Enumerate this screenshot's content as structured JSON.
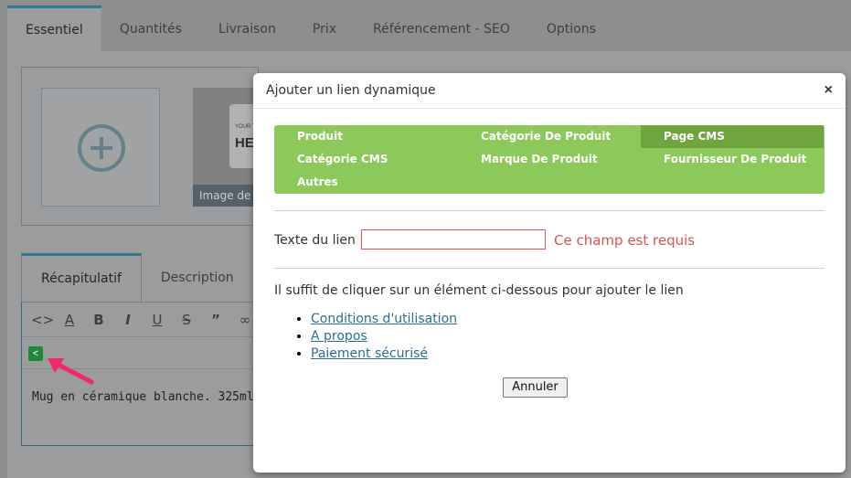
{
  "top_tabs": [
    {
      "label": "Essentiel",
      "active": true
    },
    {
      "label": "Quantités",
      "active": false
    },
    {
      "label": "Livraison",
      "active": false
    },
    {
      "label": "Prix",
      "active": false
    },
    {
      "label": "Référencement - SEO",
      "active": false
    },
    {
      "label": "Options",
      "active": false
    }
  ],
  "image_panel": {
    "thumb_caption": "Image de c",
    "mug_brand_small": "YOUR T",
    "mug_brand_big": "HE"
  },
  "editor": {
    "tabs": [
      {
        "label": "Récapitulatif",
        "active": true
      },
      {
        "label": "Description",
        "active": false
      }
    ],
    "toolbar_icons": [
      "code-icon",
      "font-color-icon",
      "bold-icon",
      "italic-icon",
      "underline-icon",
      "strikethrough-icon",
      "quote-icon",
      "link-icon"
    ],
    "toolbar_glyphs": [
      "<>",
      "A",
      "B",
      "I",
      "U",
      "S",
      "”",
      "∞"
    ],
    "share_glyph": "<",
    "content": "Mug en céramique blanche. 325ml"
  },
  "modal": {
    "title": "Ajouter un lien dynamique",
    "close_glyph": "×",
    "link_types": [
      {
        "label": "Produit",
        "selected": false
      },
      {
        "label": "Catégorie De Produit",
        "selected": false
      },
      {
        "label": "Page CMS",
        "selected": true
      },
      {
        "label": "Catégorie CMS",
        "selected": false
      },
      {
        "label": "Marque De Produit",
        "selected": false
      },
      {
        "label": "Fournisseur De Produit",
        "selected": false
      },
      {
        "label": "Autres",
        "selected": false
      }
    ],
    "link_text_label": "Texte du lien :",
    "link_text_value": "",
    "link_text_error": "Ce champ est requis",
    "hint": "Il suffit de cliquer sur un élément ci-dessous pour ajouter le lien",
    "cms_pages": [
      "Conditions d'utilisation",
      "A propos",
      "Paiement sécurisé"
    ],
    "cancel_label": "Annuler"
  },
  "colors": {
    "accent": "#2a7d91",
    "link_type_bg": "#8dc85b",
    "link_type_selected": "#6fa43f",
    "error": "#d9534f",
    "annotation_arrow": "#f0286e"
  }
}
